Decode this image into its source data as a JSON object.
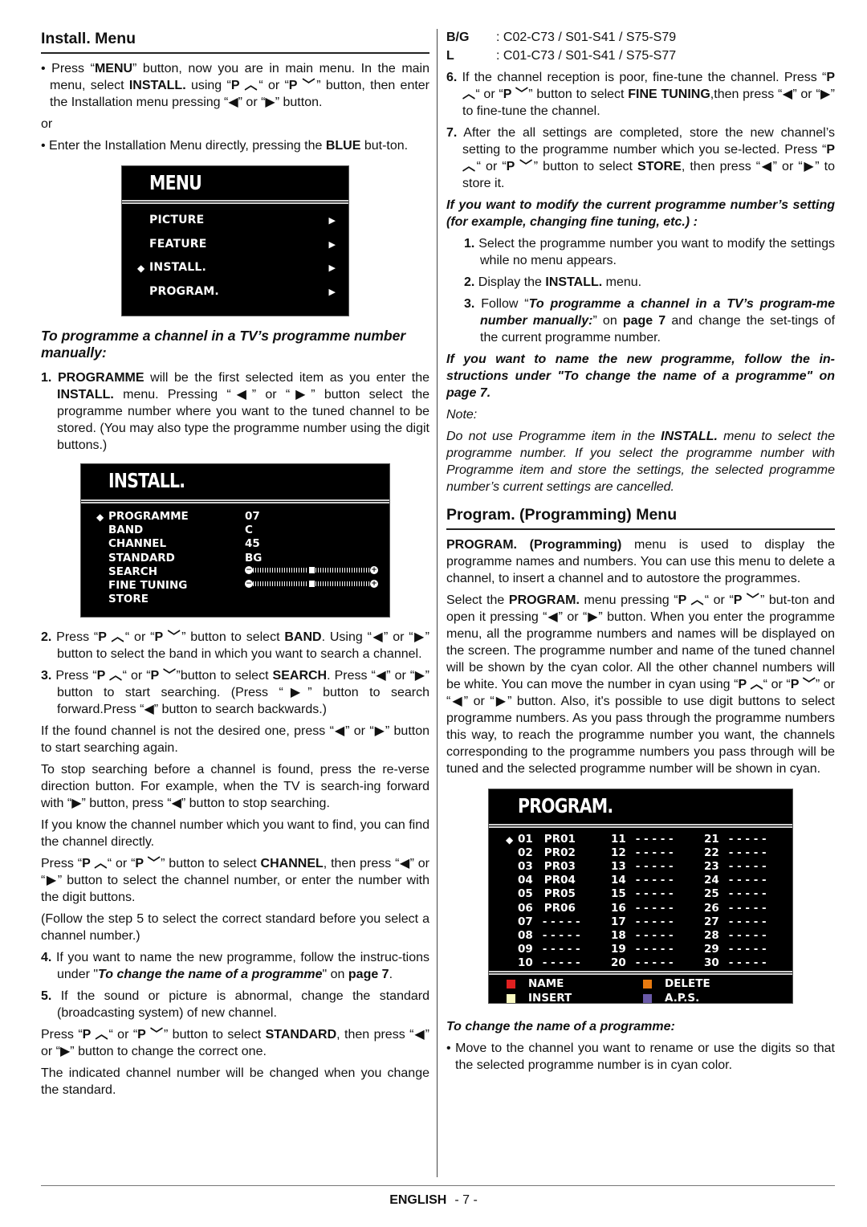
{
  "left": {
    "title": "Install. Menu",
    "intro_bullet_1": {
      "pre": "Press “",
      "b1": "MENU",
      "mid1": "” button, now you are in main menu. In the main menu, select ",
      "b2": "INSTALL.",
      "mid2": " using “",
      "pup": "P ︿",
      "mid3": "“ or “",
      "pdown": "P ﹀",
      "mid4": "” button, then enter the Installation menu pressing “◀” or “▶” button."
    },
    "or_text": "or",
    "intro_bullet_2": {
      "pre": "Enter the Installation Menu directly, pressing the ",
      "b1": "BLUE",
      "post": " but-ton."
    },
    "menu_osd": {
      "title": "MENU",
      "items": [
        {
          "label": "PICTURE",
          "selected": false
        },
        {
          "label": "FEATURE",
          "selected": false
        },
        {
          "label": "INSTALL.",
          "selected": true
        },
        {
          "label": "PROGRAM.",
          "selected": false
        }
      ]
    },
    "manual_heading": "To programme a channel in a TV’s programme number manually:",
    "step1": {
      "n": "1.",
      "b1": "PROGRAMME",
      "t1": " will be the first selected item as you enter the ",
      "b2": "INSTALL.",
      "t2": " menu. Pressing “◀” or “▶” button select the programme number where you want to the tuned channel to be stored. (You may also type the programme number using the digit buttons.)"
    },
    "install_osd": {
      "title": "INSTALL.",
      "rows": [
        {
          "label": "PROGRAMME",
          "value": "07",
          "selected": true
        },
        {
          "label": "BAND",
          "value": "C"
        },
        {
          "label": "CHANNEL",
          "value": "45"
        },
        {
          "label": "STANDARD",
          "value": "BG"
        },
        {
          "label": "SEARCH",
          "slider": 0.5
        },
        {
          "label": "FINE TUNING",
          "slider": 0.5
        },
        {
          "label": "STORE",
          "value": ""
        }
      ]
    },
    "step2": {
      "n": "2.",
      "t1": " Press “",
      "pup": "P ︿",
      "t2": "“ or “",
      "pdown": "P ﹀",
      "t3": "” button to select ",
      "b1": "BAND",
      "t4": ". Using “◀” or “▶” button to select the band in which you want to search a channel."
    },
    "step3": {
      "n": "3.",
      "t1": " Press “",
      "pup": "P ︿",
      "t2": "“ or “",
      "pdown": "P ﹀",
      "t3": "”button to select ",
      "b1": "SEARCH",
      "t4": ". Press “◀” or “▶” button to start searching. (Press “▶” button to search forward.Press “◀” button to search backwards.)"
    },
    "para_found": "If the found channel is not the desired one, press “◀” or “▶” button to start searching again.",
    "para_stop": "To stop searching before a channel is found, press the re-verse direction button. For example, when the TV is search-ing forward with “▶” button, press “◀” button to stop searching.",
    "para_know": "If you know the channel number which you want to find, you can find the channel directly.",
    "para_channel": {
      "t1": "Press “",
      "pup": "P ︿",
      "t2": "“ or “",
      "pdown": "P ﹀",
      "t3": "” button to select ",
      "b1": "CHANNEL",
      "t4": ", then press “◀” or “▶” button to select the channel number, or enter the number with the digit buttons."
    },
    "para_follow": "(Follow the step 5 to select the correct standard before you select a channel number.)",
    "step4": {
      "n": "4.",
      "t1": " If you want to name the new programme, follow the instruc-tions under \"",
      "bi": "To change the name of a programme",
      "t2": "\" on ",
      "b1": "page 7",
      "t3": "."
    },
    "step5": {
      "n": "5.",
      "t1": " If the sound or picture is abnormal, change the standard (broadcasting system) of new channel."
    },
    "para_standard": {
      "t1": "Press “",
      "pup": "P ︿",
      "t2": "“ or “",
      "pdown": "P ﹀",
      "t3": "” button to select ",
      "b1": "STANDARD",
      "t4": ", then press “◀” or “▶” button to change the correct one."
    },
    "para_indicated": "The indicated channel number will be changed when you change the standard."
  },
  "right": {
    "ranges": [
      {
        "label": "B/G",
        "value": ": C02-C73 / S01-S41 / S75-S79"
      },
      {
        "label": "L",
        "value": ": C01-C73 / S01-S41 / S75-S77"
      }
    ],
    "step6": {
      "n": "6.",
      "t1": " If the channel reception is poor, fine-tune the channel. Press “",
      "pup": "P ︿",
      "t2": "“ or “",
      "pdown": "P ﹀",
      "t3": "” button to select ",
      "b1": "FINE TUNING",
      "t4": ",then press “◀” or “▶” to fine-tune the channel."
    },
    "step7": {
      "n": "7.",
      "t1": " After the all settings are completed, store the new channel’s setting to the programme number which you se-lected. Press “",
      "pup": "P ︿",
      "t2": "“ or “",
      "pdown": "P ﹀",
      "t3": "” button to select ",
      "b1": "STORE",
      "t4": ", then press “◀” or “▶” to store it."
    },
    "modify_heading": "If you want to modify the current programme number’s setting (for example, changing fine tuning, etc.) :",
    "modify_steps": {
      "s1": {
        "n": "1.",
        "t": " Select the programme number you want to modify the settings while no menu appears."
      },
      "s2": {
        "n": "2.",
        "t1": " Display the ",
        "b1": "INSTALL.",
        "t2": " menu."
      },
      "s3": {
        "n": "3.",
        "t1": " Follow “",
        "bi": "To programme a channel in a TV’s program-me number manually:",
        "t2": "” on ",
        "b1": "page 7",
        "t3": " and change the set-tings of the current programme number."
      }
    },
    "name_heading": "If you want to name the new programme, follow the in-structions under \"To change the name of a programme\" on page 7.",
    "note_label": "Note:",
    "note": {
      "t1": "Do not use Programme item in the ",
      "b1": "INSTALL.",
      "t2": " menu to select the programme number. If you select the programme number with Programme item and store the settings, the selected programme number’s current settings are cancelled."
    },
    "program_title": "Program. (Programming) Menu",
    "program_p1": {
      "b1": "PROGRAM. (Programming)",
      "t1": " menu is used to display the programme names and numbers. You can use this menu to delete a channel, to insert a channel and to autostore the programmes."
    },
    "program_p2": {
      "t1": "Select the ",
      "b1": "PROGRAM.",
      "t2": " menu pressing “",
      "pup": "P ︿",
      "t3": "“ or “",
      "pdown": "P ﹀",
      "t4": "” but-ton and open it pressing “◀” or “▶” button. When you enter the programme menu, all the programme numbers and names will be displayed on the screen. The programme number and name of the tuned channel will be shown by the cyan color. All the other channel numbers will be white. You can move the number in cyan using “",
      "pup2": "P ︿",
      "t5": "“ or “",
      "pdown2": "P ﹀",
      "t6": "” or “◀” or “▶” button. Also, it's possible to use digit buttons to select programme numbers. As you pass through the programme numbers this way, to reach the programme number you want, the channels corresponding to the programme numbers you pass through will be tuned and the selected programme number will be shown in cyan."
    },
    "program_osd": {
      "title": "PROGRAM.",
      "selected_index": 0,
      "entries": [
        {
          "num": "01",
          "name": "PR01"
        },
        {
          "num": "02",
          "name": "PR02"
        },
        {
          "num": "03",
          "name": "PR03"
        },
        {
          "num": "04",
          "name": "PR04"
        },
        {
          "num": "05",
          "name": "PR05"
        },
        {
          "num": "06",
          "name": "PR06"
        },
        {
          "num": "07",
          "name": "- - - - -"
        },
        {
          "num": "08",
          "name": "- - - - -"
        },
        {
          "num": "09",
          "name": "- - - - -"
        },
        {
          "num": "10",
          "name": "- - - - -"
        },
        {
          "num": "11",
          "name": "- - - - -"
        },
        {
          "num": "12",
          "name": "- - - - -"
        },
        {
          "num": "13",
          "name": "- - - - -"
        },
        {
          "num": "14",
          "name": "- - - - -"
        },
        {
          "num": "15",
          "name": "- - - - -"
        },
        {
          "num": "16",
          "name": "- - - - -"
        },
        {
          "num": "17",
          "name": "- - - - -"
        },
        {
          "num": "18",
          "name": "- - - - -"
        },
        {
          "num": "19",
          "name": "- - - - -"
        },
        {
          "num": "20",
          "name": "- - - - -"
        },
        {
          "num": "21",
          "name": "- - - - -"
        },
        {
          "num": "22",
          "name": "- - - - -"
        },
        {
          "num": "23",
          "name": "- - - - -"
        },
        {
          "num": "24",
          "name": "- - - - -"
        },
        {
          "num": "25",
          "name": "- - - - -"
        },
        {
          "num": "26",
          "name": "- - - - -"
        },
        {
          "num": "27",
          "name": "- - - - -"
        },
        {
          "num": "28",
          "name": "- - - - -"
        },
        {
          "num": "29",
          "name": "- - - - -"
        },
        {
          "num": "30",
          "name": "- - - - -"
        }
      ],
      "legend": [
        {
          "label": "NAME",
          "color": "#e02020"
        },
        {
          "label": "DELETE",
          "color": "#e87a10"
        },
        {
          "label": "INSERT",
          "color": "#fafac0"
        },
        {
          "label": "A.P.S.",
          "color": "#6a5aa8"
        }
      ]
    },
    "change_name_heading": "To change the name of a programme:",
    "change_name_bullet": "Move to the channel you want to rename or use the digits so that the selected programme number is in cyan color."
  },
  "footer": {
    "language": "ENGLISH",
    "page": "- 7 -"
  }
}
